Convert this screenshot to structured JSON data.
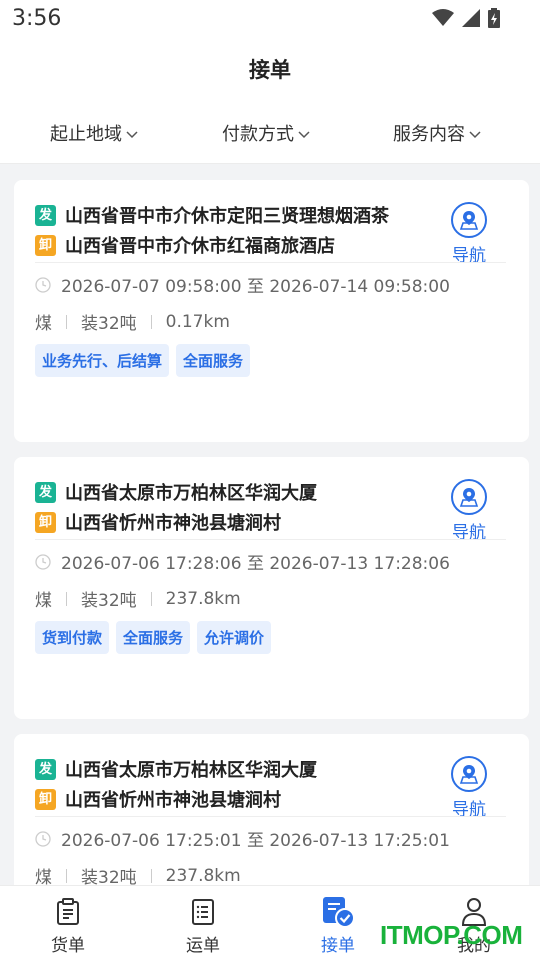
{
  "status_bar": {
    "time": "3:56",
    "icons": [
      "wifi-icon",
      "signal-icon",
      "battery-icon"
    ]
  },
  "header": {
    "title": "接单"
  },
  "filters": [
    {
      "label": "起止地域",
      "icon": "chevron-down-icon"
    },
    {
      "label": "付款方式",
      "icon": "chevron-down-icon"
    },
    {
      "label": "服务内容",
      "icon": "chevron-down-icon"
    }
  ],
  "orders": [
    {
      "send_tag": "发",
      "unload_tag": "卸",
      "from": "山西省晋中市介休市定阳三贤理想烟酒茶",
      "to": "山西省晋中市介休市红福商旅酒店",
      "nav_label": "导航",
      "time_text": "2026-07-07 09:58:00 至 2026-07-14 09:58:00",
      "goods": "煤",
      "load": "装32吨",
      "distance": "0.17km",
      "chips": [
        "业务先行、后结算",
        "全面服务"
      ]
    },
    {
      "send_tag": "发",
      "unload_tag": "卸",
      "from": "山西省太原市万柏林区华润大厦",
      "to": "山西省忻州市神池县塘涧村",
      "nav_label": "导航",
      "time_text": "2026-07-06 17:28:06 至 2026-07-13 17:28:06",
      "goods": "煤",
      "load": "装32吨",
      "distance": "237.8km",
      "chips": [
        "货到付款",
        "全面服务",
        "允许调价"
      ]
    },
    {
      "send_tag": "发",
      "unload_tag": "卸",
      "from": "山西省太原市万柏林区华润大厦",
      "to": "山西省忻州市神池县塘涧村",
      "nav_label": "导航",
      "time_text": "2026-07-06 17:25:01 至 2026-07-13 17:25:01",
      "goods": "煤",
      "load": "装32吨",
      "distance": "237.8km",
      "chips": []
    }
  ],
  "tabs": [
    {
      "label": "货单",
      "icon": "clipboard-icon",
      "active": false
    },
    {
      "label": "运单",
      "icon": "list-icon",
      "active": false
    },
    {
      "label": "接单",
      "icon": "accept-order-icon",
      "active": true
    },
    {
      "label": "我的",
      "icon": "user-icon",
      "active": false
    }
  ],
  "watermark": "ITMOP.COM",
  "colors": {
    "accent": "#2b6fe5",
    "send_tag": "#1ab394",
    "unload_tag": "#f5a623",
    "chip_bg": "#e8f0fd",
    "watermark": "#19b23b"
  }
}
